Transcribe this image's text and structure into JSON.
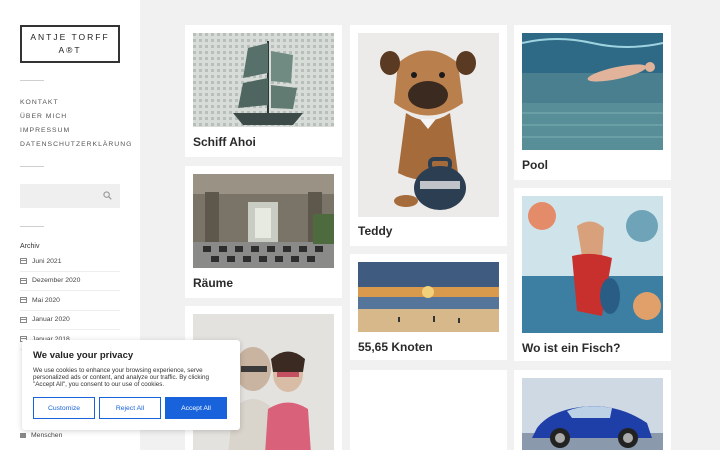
{
  "logo": {
    "line1": "ANTJE TORFF",
    "line2": "A®T"
  },
  "menu": [
    "KONTAKT",
    "ÜBER MICH",
    "IMPRESSUM",
    "DATENSCHUTZERKLÄRUNG"
  ],
  "search": {
    "placeholder": ""
  },
  "archive": {
    "title": "Archiv",
    "items": [
      "Juni 2021",
      "Dezember 2020",
      "Mai 2020",
      "Januar 2020",
      "Januar 2018"
    ]
  },
  "category": {
    "label": "Menschen"
  },
  "cards": {
    "schiff": "Schiff Ahoi",
    "raeume": "Räume",
    "teddy": "Teddy",
    "knoten": "55,65 Knoten",
    "pool": "Pool",
    "fisch": "Wo ist ein Fisch?"
  },
  "cookie": {
    "title": "We value your privacy",
    "text": "We use cookies to enhance your browsing experience, serve personalized ads or content, and analyze our traffic. By clicking \"Accept All\", you consent to our use of cookies.",
    "customize": "Customize",
    "reject": "Reject All",
    "accept": "Accept All"
  },
  "colors": {
    "accent": "#1863dc",
    "background": "#f1f1f1"
  }
}
